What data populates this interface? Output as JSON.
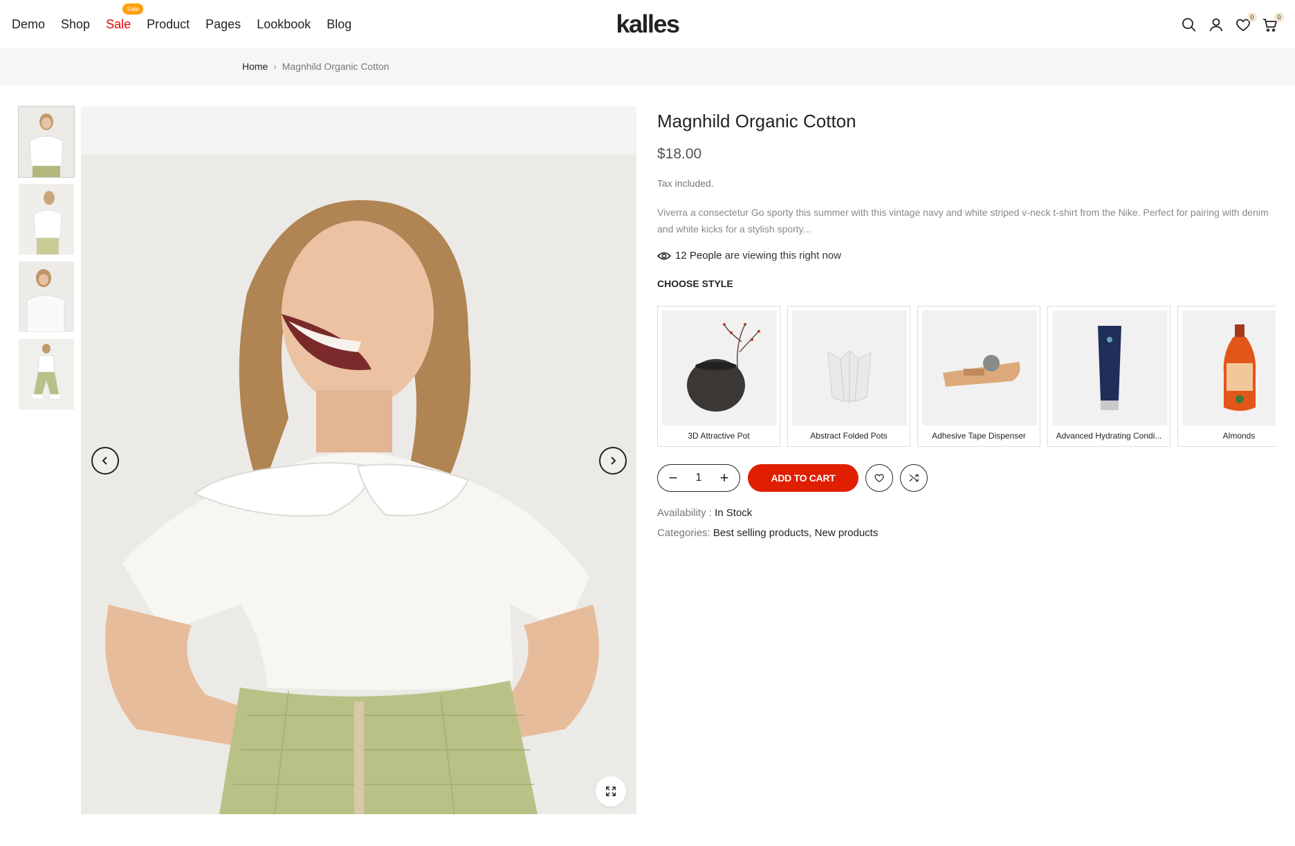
{
  "header": {
    "nav": [
      {
        "label": "Demo"
      },
      {
        "label": "Shop"
      },
      {
        "label": "Sale",
        "badge": "Sale"
      },
      {
        "label": "Product"
      },
      {
        "label": "Pages"
      },
      {
        "label": "Lookbook"
      },
      {
        "label": "Blog"
      }
    ],
    "logo": "kalles",
    "wishlist_count": "0",
    "cart_count": "0"
  },
  "breadcrumb": {
    "home": "Home",
    "current": "Magnhild Organic Cotton"
  },
  "product": {
    "title": "Magnhild Organic Cotton",
    "price": "$18.00",
    "tax_note": "Tax included.",
    "description": "Viverra a consectetur Go sporty this summer with this vintage navy and white striped v-neck t-shirt from the Nike. Perfect for pairing with denim and white kicks for a stylish sporty...",
    "viewing_count": "12 People",
    "viewing_text": "are viewing this right now",
    "choose_style_label": "CHOOSE STYLE",
    "styles": [
      {
        "label": "3D Attractive Pot"
      },
      {
        "label": "Abstract Folded Pots"
      },
      {
        "label": "Adhesive Tape Dispenser"
      },
      {
        "label": "Advanced Hydrating Condi..."
      },
      {
        "label": "Almonds"
      }
    ],
    "quantity": "1",
    "add_to_cart": "ADD TO CART",
    "availability_label": "Availability :",
    "availability_value": "In Stock",
    "categories_label": "Categories:",
    "categories": [
      "Best selling products",
      "New products"
    ]
  },
  "colors": {
    "accent": "#e01f00",
    "sale": "#ec0101",
    "badge": "#ff9f0a"
  }
}
